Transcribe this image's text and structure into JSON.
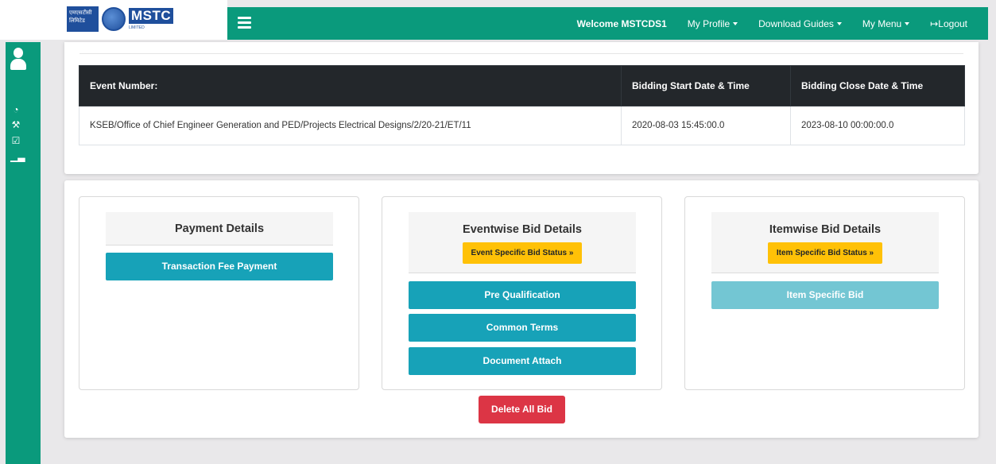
{
  "logo": {
    "hindi_text": "एमएसटीसी लिमिटेड",
    "brand": "MSTC",
    "sub": "LIMITED"
  },
  "nav": {
    "welcome": "Welcome MSTCDS1",
    "my_profile": "My Profile",
    "download_guides": "Download Guides",
    "my_menu": "My Menu",
    "logout": "Logout"
  },
  "table": {
    "headers": [
      "Event Number:",
      "Bidding Start Date & Time",
      "Bidding Close Date & Time"
    ],
    "rows": [
      [
        "KSEB/Office of Chief Engineer Generation and PED/Projects Electrical Designs/2/20-21/ET/11",
        "2020-08-03 15:45:00.0",
        "2023-08-10 00:00:00.0"
      ]
    ]
  },
  "payment": {
    "title": "Payment Details",
    "transaction_fee": "Transaction Fee Payment"
  },
  "eventwise": {
    "title": "Eventwise Bid Details",
    "status_button": "Event Specific Bid Status »",
    "pre_qualification": "Pre Qualification",
    "common_terms": "Common Terms",
    "document_attach": "Document Attach"
  },
  "itemwise": {
    "title": "Itemwise Bid Details",
    "status_button": "Item Specific Bid Status »",
    "item_specific_bid": "Item Specific Bid"
  },
  "delete_all_bid": "Delete All Bid",
  "colors": {
    "brand_green": "#0a9a7c",
    "teal": "#17a2b8",
    "warning": "#ffc107",
    "danger": "#dc3545",
    "table_dark": "#23272b"
  }
}
